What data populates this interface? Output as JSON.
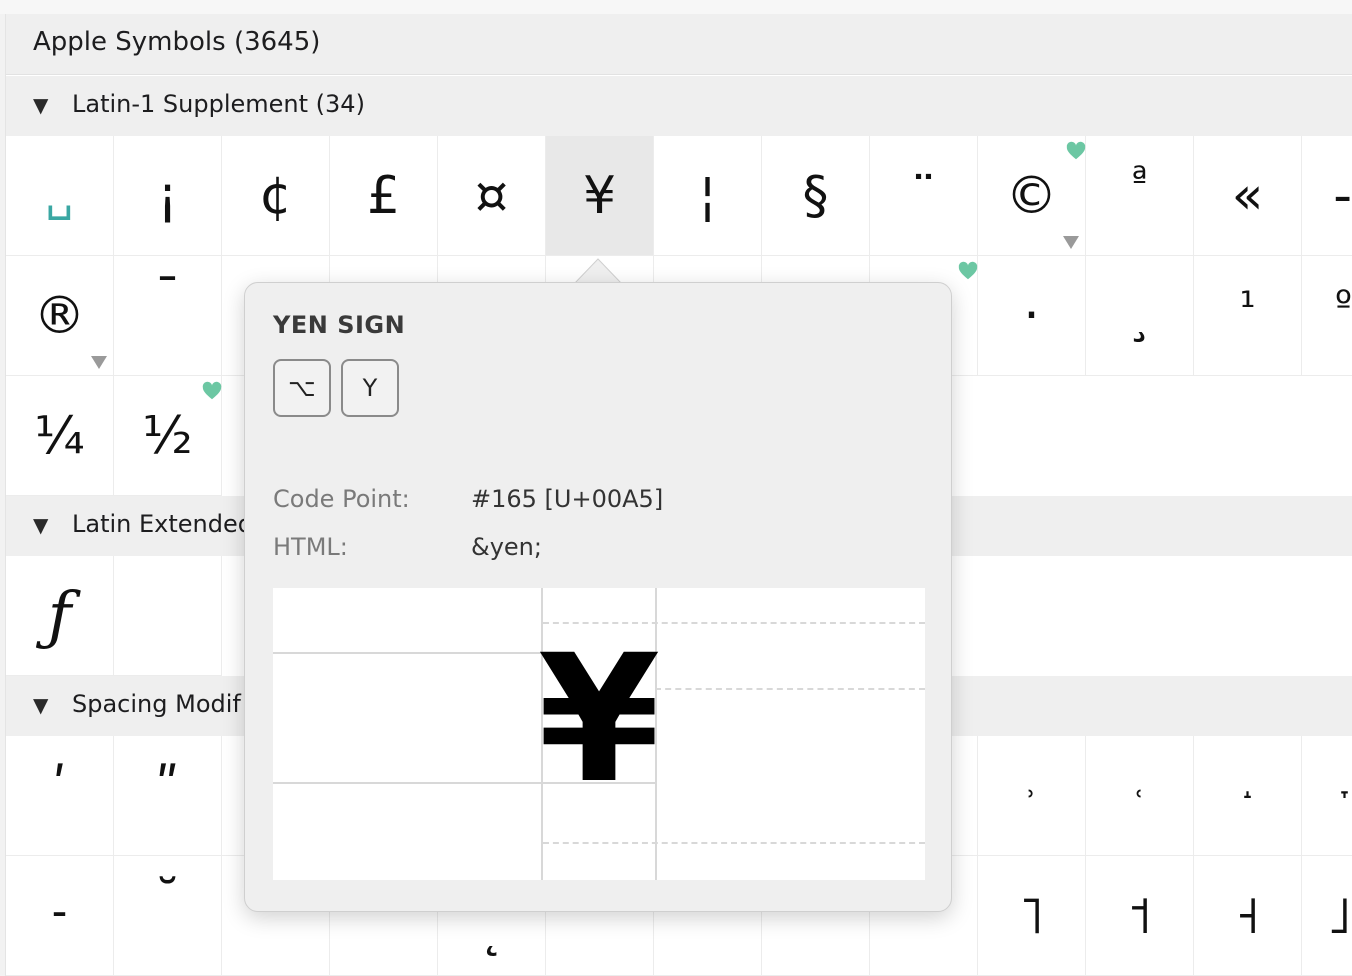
{
  "font_header": {
    "label": "Apple Symbols (3645)"
  },
  "sections": {
    "latin1": {
      "label": "Latin-1 Supplement (34)"
    },
    "latin_ext": {
      "label": "Latin Extended"
    },
    "spacing": {
      "label": "Spacing Modif"
    }
  },
  "glyph_rows": {
    "row1": [
      "␣",
      "¡",
      "¢",
      "£",
      "¤",
      "¥",
      "¦",
      "§",
      "¨",
      "©",
      "ª",
      "«",
      "-"
    ],
    "row2": [
      "®",
      "¯",
      "",
      "",
      "",
      "",
      "",
      "",
      "",
      "·",
      "¸",
      "¹",
      "º"
    ],
    "row3": [
      "¼",
      "½"
    ],
    "row4": [
      "ƒ"
    ],
    "row5": [
      "ʹ",
      "ʺ",
      "",
      "",
      "",
      "",
      "",
      "",
      "",
      "˒",
      "˓",
      "˔",
      "˕"
    ],
    "row6": [
      "˗",
      "˘",
      "",
      "˛",
      "",
      "",
      "",
      "˝",
      "˥",
      "˦",
      "˧",
      "˨",
      "˩"
    ]
  },
  "popover": {
    "title": "YEN SIGN",
    "keys": [
      "⌥",
      "Y"
    ],
    "code_point_label": "Code Point:",
    "code_point_value": "#165 [U+00A5]",
    "html_label": "HTML:",
    "html_value": "&yen;",
    "preview_glyph": "¥"
  },
  "colors": {
    "heart": "#6cc7a3",
    "selected_cell": "#e8e8e8",
    "section_bg": "#efefef"
  }
}
